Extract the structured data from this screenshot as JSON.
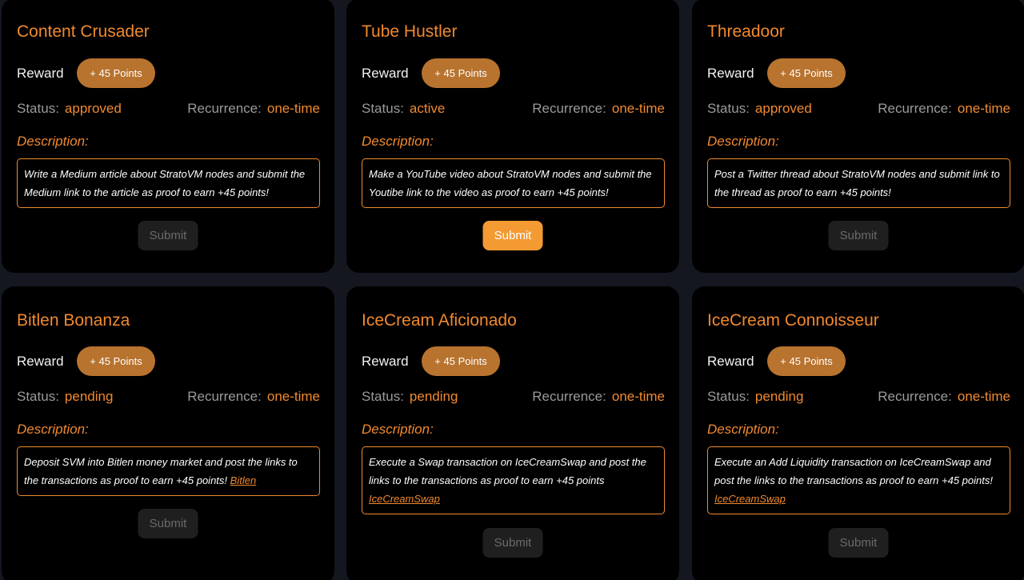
{
  "labels": {
    "reward": "Reward",
    "status": "Status:",
    "recurrence": "Recurrence:",
    "description": "Description:",
    "submit": "Submit"
  },
  "cards": [
    {
      "title": "Content Crusader",
      "points": "+ 45 Points",
      "status": "approved",
      "recurrence": "one-time",
      "description": "Write a Medium article about StratoVM nodes and submit the Medium link to the article as proof to earn +45 points!",
      "link": "",
      "submit_enabled": false
    },
    {
      "title": "Tube Hustler",
      "points": "+ 45 Points",
      "status": "active",
      "recurrence": "one-time",
      "description": "Make a YouTube video about StratoVM nodes and submit the Youtibe link to the video as proof to earn +45 points!",
      "link": "",
      "submit_enabled": true
    },
    {
      "title": "Threadoor",
      "points": "+ 45 Points",
      "status": "approved",
      "recurrence": "one-time",
      "description": "Post a Twitter thread about StratoVM nodes and submit link to the thread as proof to earn +45 points!",
      "link": "",
      "submit_enabled": false
    },
    {
      "title": "Bitlen Bonanza",
      "points": "+ 45 Points",
      "status": "pending",
      "recurrence": "one-time",
      "description": "Deposit SVM into Bitlen money market and post the links to the transactions as proof to earn +45 points!",
      "link": "Bitlen",
      "submit_enabled": false
    },
    {
      "title": "IceCream Aficionado",
      "points": "+ 45 Points",
      "status": "pending",
      "recurrence": "one-time",
      "description": "Execute a Swap transaction on IceCreamSwap and post the links to the transactions as proof to earn +45 points",
      "link": "IceCreamSwap",
      "submit_enabled": false
    },
    {
      "title": "IceCream Connoisseur",
      "points": "+ 45 Points",
      "status": "pending",
      "recurrence": "one-time",
      "description": "Execute an Add Liquidity transaction on IceCreamSwap and post the links to the transactions as proof to earn +45 points!",
      "link": "IceCreamSwap",
      "submit_enabled": false
    }
  ],
  "colors": {
    "accent": "#f0892f",
    "badge": "#b8732f",
    "submit_active": "#f39a33",
    "submit_disabled": "#1f1f1f"
  }
}
